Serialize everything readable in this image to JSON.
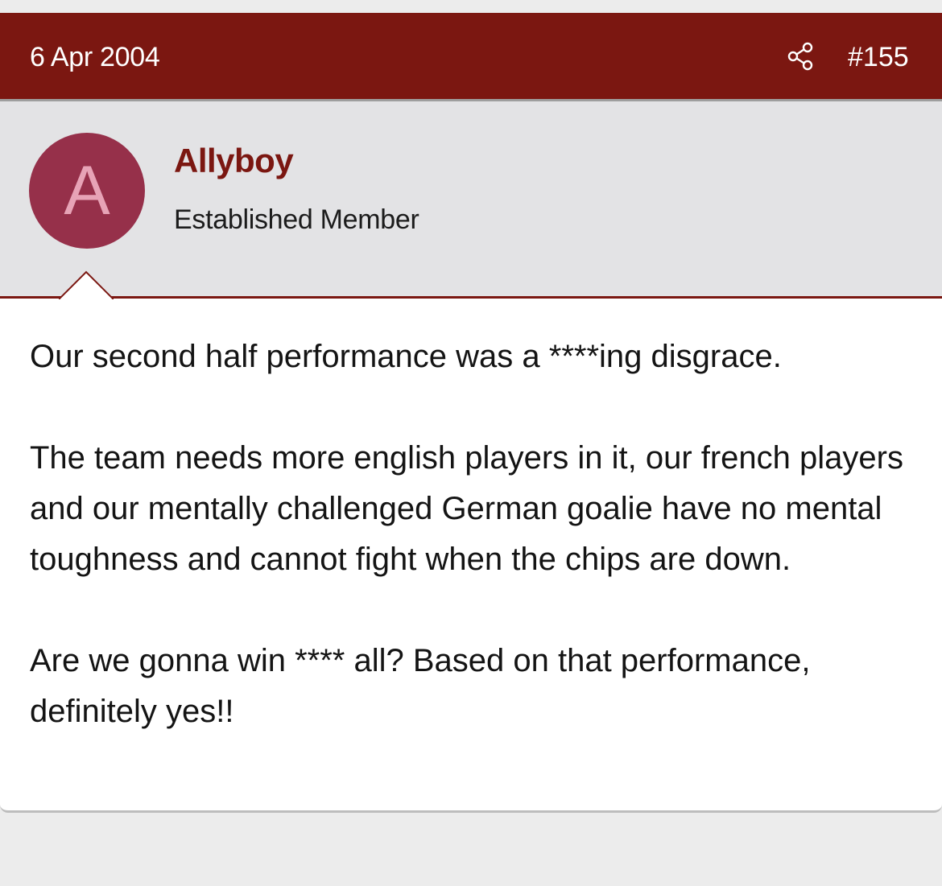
{
  "post": {
    "date": "6 Apr 2004",
    "number": "#155",
    "share_icon": "share-icon",
    "author": {
      "avatar_letter": "A",
      "avatar_color": "#96304a",
      "name": "Allyboy",
      "title": "Established Member"
    },
    "body": [
      "Our second half performance was a ****ing disgrace.",
      "The team needs more english players in it, our french players and our mentally challenged German goalie have no mental toughness and cannot fight when the chips are down.",
      "Are we gonna win **** all? Based on that performance, definitely yes!!"
    ]
  },
  "colors": {
    "header_bg": "#7b1711",
    "user_block_bg": "#e3e3e5",
    "username": "#7b1711"
  }
}
